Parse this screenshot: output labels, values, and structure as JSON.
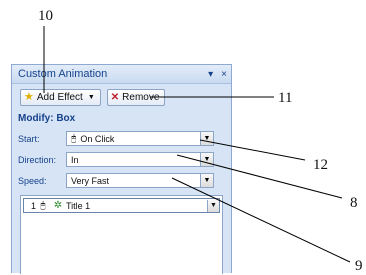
{
  "callouts": {
    "c10": "10",
    "c11": "11",
    "c12": "12",
    "c8": "8",
    "c9": "9"
  },
  "pane": {
    "title": "Custom Animation",
    "menu_glyph": "▾",
    "close_glyph": "×"
  },
  "toolbar": {
    "add_effect_label": "Add Effect",
    "remove_label": "Remove"
  },
  "modify": {
    "title": "Modify: Box",
    "start_label": "Start:",
    "start_value": "On Click",
    "direction_label": "Direction:",
    "direction_value": "In",
    "speed_label": "Speed:",
    "speed_value": "Very Fast"
  },
  "animation_list": [
    {
      "order": "1",
      "name": "Title 1"
    }
  ],
  "icons": {
    "star": "star-icon",
    "remove": "remove-x-icon",
    "mouse": "mouse-click-icon",
    "effect": "green-effect-star-icon"
  }
}
